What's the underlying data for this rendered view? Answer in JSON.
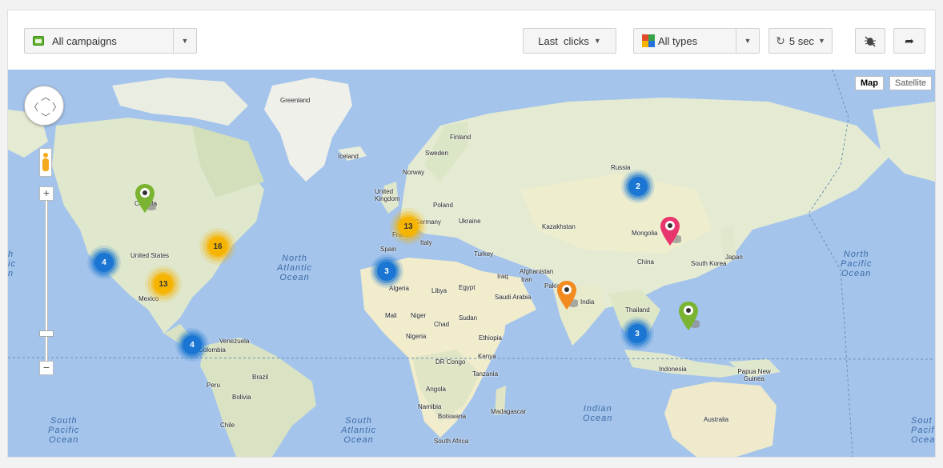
{
  "toolbar": {
    "campaigns": {
      "label": "All campaigns",
      "icon": "folder-icon"
    },
    "last": {
      "label": "Last  clicks"
    },
    "types": {
      "label": "All types",
      "icon": "types-grid-icon",
      "colors": [
        "#e14a2a",
        "#3aa24a",
        "#f4b400",
        "#2573d8"
      ]
    },
    "refresh": {
      "label": "5 sec",
      "icon": "refresh-icon"
    },
    "bug": {
      "icon": "bug-icon"
    },
    "share": {
      "icon": "share-icon"
    }
  },
  "map": {
    "type_map": "Map",
    "type_satellite": "Satellite",
    "countries": [
      "Greenland",
      "Iceland",
      "Finland",
      "Sweden",
      "Norway",
      "United Kingdom",
      "Poland",
      "Germany",
      "Ukraine",
      "France",
      "Italy",
      "Spain",
      "Turkey",
      "Kazakhstan",
      "Russia",
      "Mongolia",
      "China",
      "Japan",
      "South Korea",
      "Afghanistan",
      "Iran",
      "Iraq",
      "Pakistan",
      "India",
      "Saudi Arabia",
      "Algeria",
      "Libya",
      "Egypt",
      "Mali",
      "Niger",
      "Chad",
      "Sudan",
      "Nigeria",
      "Ethiopia",
      "Kenya",
      "DR Congo",
      "Tanzania",
      "Angola",
      "Namibia",
      "Botswana",
      "Madagascar",
      "South Africa",
      "Thailand",
      "Indonesia",
      "Papua New Guinea",
      "Australia",
      "Canada",
      "United States",
      "Mexico",
      "Venezuela",
      "Colombia",
      "Brazil",
      "Peru",
      "Bolivia",
      "Chile"
    ],
    "oceans": {
      "north_atlantic": "North\nAtlantic\nOcean",
      "south_atlantic": "South\nAtlantic\nOcean",
      "north_pacific": "North\nPacific\nOcean",
      "south_pacific": "South\nPacific\nOcean",
      "indian": "Indian\nOcean",
      "south_pacific_right": "Sout\nPacif\nOcea",
      "north_pacific_left": "h\nic\nn"
    },
    "clusters": [
      {
        "count": "4",
        "color": "blue"
      },
      {
        "count": "13",
        "color": "orange"
      },
      {
        "count": "16",
        "color": "orange"
      },
      {
        "count": "4",
        "color": "blue"
      },
      {
        "count": "13",
        "color": "orange"
      },
      {
        "count": "3",
        "color": "blue"
      },
      {
        "count": "2",
        "color": "blue"
      },
      {
        "count": "3",
        "color": "blue"
      }
    ],
    "pins": [
      {
        "color": "#7ab432"
      },
      {
        "color": "#e8356d"
      },
      {
        "color": "#f28a1f"
      },
      {
        "color": "#7ab432"
      }
    ]
  }
}
